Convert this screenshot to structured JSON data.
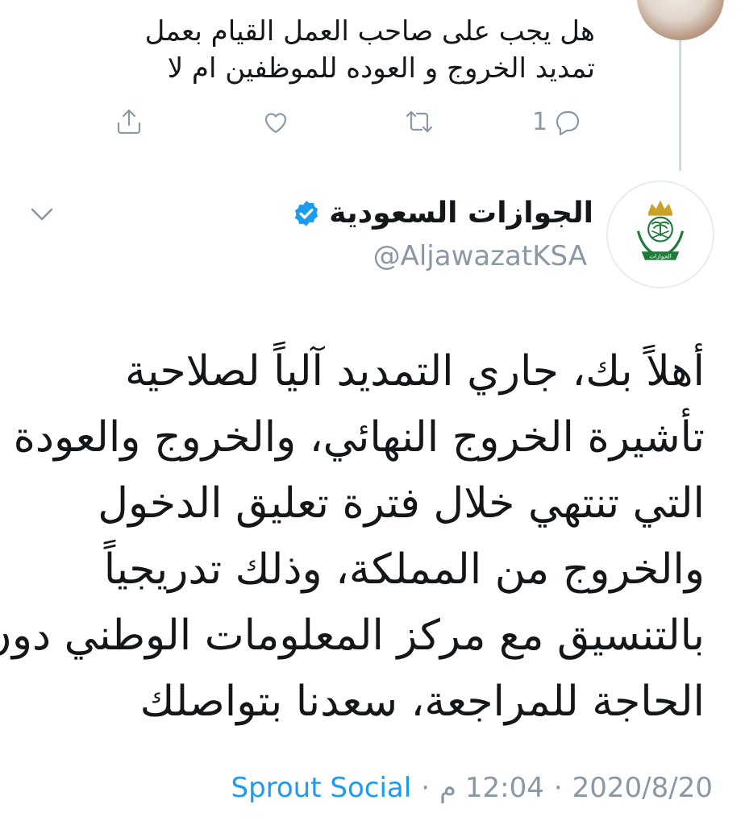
{
  "reply_tweet": {
    "lines": [
      "هل يجب على صاحب العمل القيام بعمل",
      "تمديد الخروج و العوده للموظفين ام لا"
    ],
    "actions": {
      "reply_count": "1"
    }
  },
  "main_tweet": {
    "display_name": "الجوازات السعودية",
    "handle": "@AljawazatKSA",
    "body_lines": [
      "أهلاً بك، جاري التمديد آلياً لصلاحية",
      "تأشيرة الخروج النهائي، والخروج والعودة",
      "التي تنتهي خلال فترة تعليق الدخول",
      "والخروج من المملكة، وذلك تدريجياً",
      "بالتنسيق مع مركز المعلومات الوطني دون",
      "الحاجة للمراجعة، سعدنا بتواصلك"
    ],
    "logo_text": "الجوازات",
    "meta": {
      "date": "2020/8/20",
      "time": "12:04 م",
      "separator": "·",
      "source": "Sprout Social"
    }
  },
  "colors": {
    "verified": "#1d9bf0",
    "muted": "#8a98a5",
    "link": "#1d9bf0",
    "logo_green": "#1f7a3c",
    "logo_gold": "#c9a227"
  },
  "icons": {
    "reply": "reply-icon",
    "retweet": "retweet-icon",
    "like": "heart-icon",
    "share": "share-icon",
    "verified": "verified-badge-icon",
    "more": "chevron-down-icon"
  }
}
